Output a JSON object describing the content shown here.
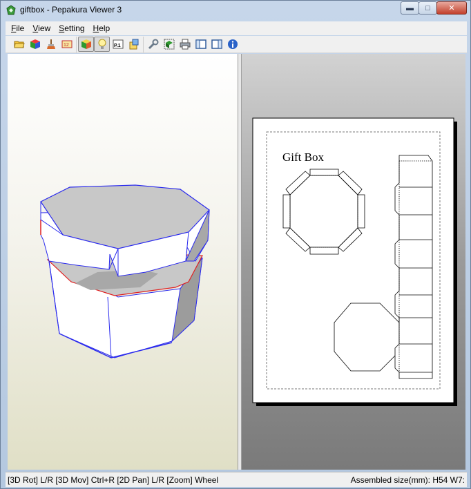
{
  "window": {
    "title": "giftbox - Pepakura Viewer 3"
  },
  "caption": {
    "minimize_icon": "minimize-icon",
    "maximize_icon": "maximize-icon",
    "close_icon": "close-icon"
  },
  "menu": {
    "items": [
      "File",
      "View",
      "Setting",
      "Help"
    ]
  },
  "toolbar": {
    "icons": [
      "open-folder-icon",
      "3d-model-icon",
      "paint-brush-icon",
      "ruler-numbering-icon",
      "cube-view-icon",
      "light-bulb-icon",
      "page-number-icon",
      "export-icon",
      "wrench-icon",
      "2d-3d-icon",
      "print-icon",
      "single-pane-icon",
      "split-pane-icon",
      "info-icon"
    ],
    "page_label": "P.1"
  },
  "paper": {
    "title": "Gift Box"
  },
  "status": {
    "left": "[3D Rot] L/R [3D Mov] Ctrl+R [2D Pan] L/R [Zoom] Wheel",
    "right": "Assembled size(mm): H54 W7:"
  },
  "colors": {
    "edge_blue": "#2a2aee",
    "edge_red": "#e02020",
    "lid_gray": "#c8c8c8"
  }
}
